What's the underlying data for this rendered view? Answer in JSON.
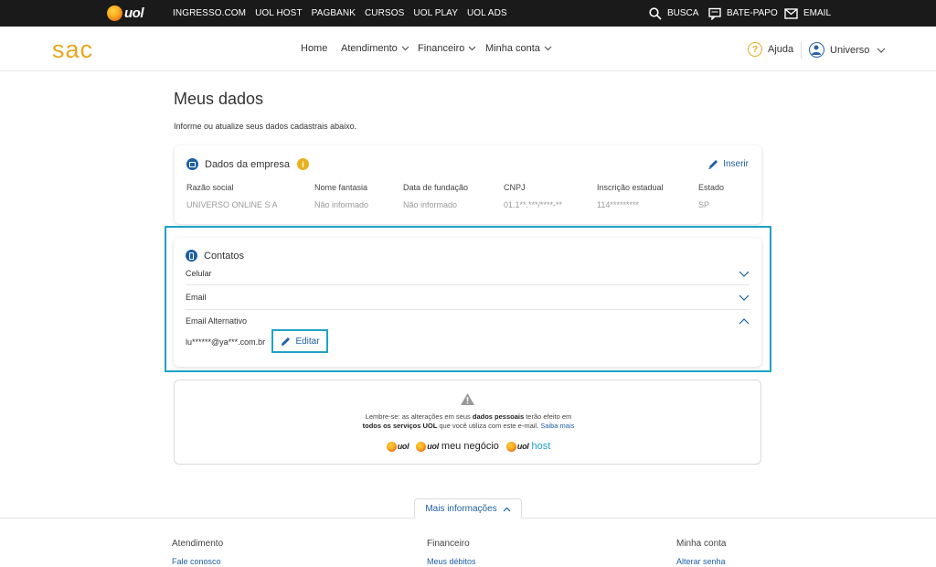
{
  "topbar": {
    "logo": "uol",
    "links": [
      "INGRESSO.COM",
      "UOL HOST",
      "PAGBANK",
      "CURSOS",
      "UOL PLAY",
      "UOL ADS"
    ],
    "search": "BUSCA",
    "chat": "BATE-PAPO",
    "email": "EMAIL"
  },
  "header": {
    "logo": "sac",
    "nav": [
      "Home",
      "Atendimento",
      "Financeiro",
      "Minha conta"
    ],
    "help": "Ajuda",
    "user": "Universo"
  },
  "page": {
    "title": "Meus dados",
    "subtitle": "Informe ou atualize seus dados cadastrais abaixo."
  },
  "company": {
    "title": "Dados da empresa",
    "insert": "Inserir",
    "columns": [
      {
        "label": "Razão social",
        "value": "UNIVERSO ONLINE S A"
      },
      {
        "label": "Nome fantasia",
        "value": "Não informado"
      },
      {
        "label": "Data de fundação",
        "value": "Não informado"
      },
      {
        "label": "CNPJ",
        "value": "01.1**.***/****-**"
      },
      {
        "label": "Inscrição estadual",
        "value": "114*********"
      },
      {
        "label": "Estado",
        "value": "SP"
      }
    ]
  },
  "contacts": {
    "title": "Contatos",
    "rows": [
      "Celular",
      "Email",
      "Email Alternativo"
    ],
    "alt_email": "lu******@ya***.com.br",
    "edit": "Editar"
  },
  "notice": {
    "t1": "Lembre-se: as alterações em seus ",
    "t2": "dados pessoais",
    "t3": " terão efeito em",
    "t4": "todos os serviços UOL",
    "t5": " que você utiliza com este e-mail. ",
    "t6": "Saiba mais",
    "brand1": "uol",
    "brand2_a": "uol",
    "brand2_b": "meu negócio",
    "brand3_a": "uol",
    "brand3_b": "host"
  },
  "footer": {
    "more": "Mais informações",
    "cols": [
      {
        "title": "Atendimento",
        "link": "Fale conosco"
      },
      {
        "title": "Financeiro",
        "link": "Meus débitos"
      },
      {
        "title": "Minha conta",
        "link": "Alterar senha"
      }
    ]
  },
  "colors": {
    "accent": "#1d5fa3",
    "brand": "#e8a81f",
    "highlight": "#1fa3c7"
  }
}
